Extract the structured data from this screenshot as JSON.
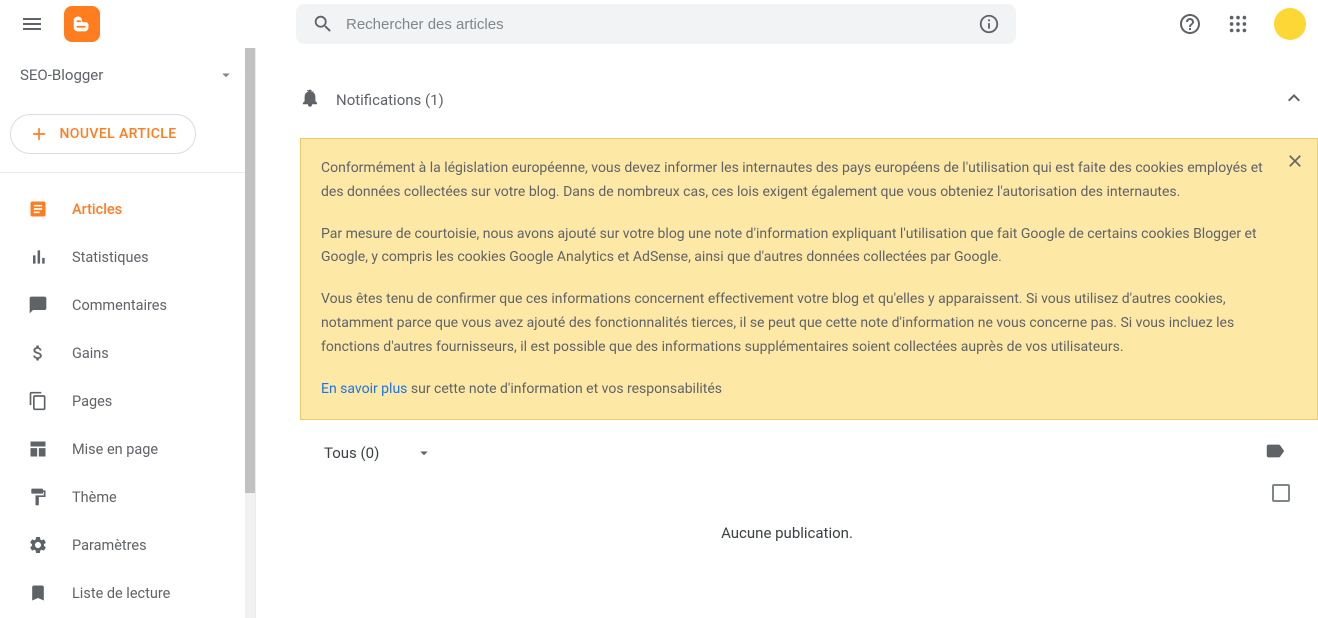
{
  "header": {
    "search_placeholder": "Rechercher des articles"
  },
  "sidebar": {
    "blog_name": "SEO-Blogger",
    "new_post_label": "NOUVEL ARTICLE",
    "nav": [
      {
        "label": "Articles",
        "icon": "doc",
        "active": true
      },
      {
        "label": "Statistiques",
        "icon": "stats",
        "active": false
      },
      {
        "label": "Commentaires",
        "icon": "comment",
        "active": false
      },
      {
        "label": "Gains",
        "icon": "dollar",
        "active": false
      },
      {
        "label": "Pages",
        "icon": "pages",
        "active": false
      },
      {
        "label": "Mise en page",
        "icon": "layout",
        "active": false
      },
      {
        "label": "Thème",
        "icon": "theme",
        "active": false
      },
      {
        "label": "Paramètres",
        "icon": "settings",
        "active": false
      },
      {
        "label": "Liste de lecture",
        "icon": "bookmark",
        "active": false
      }
    ]
  },
  "notifications": {
    "title": "Notifications (1)",
    "p1": "Conformément à la législation européenne, vous devez informer les internautes des pays européens de l'utilisation qui est faite des cookies employés et des données collectées sur votre blog. Dans de nombreux cas, ces lois exigent également que vous obteniez l'autorisation des internautes.",
    "p2": "Par mesure de courtoisie, nous avons ajouté sur votre blog une note d'information expliquant l'utilisation que fait Google de certains cookies Blogger et Google, y compris les cookies Google Analytics et AdSense, ainsi que d'autres données collectées par Google.",
    "p3": "Vous êtes tenu de confirmer que ces informations concernent effectivement votre blog et qu'elles y apparaissent. Si vous utilisez d'autres cookies, notamment parce que vous avez ajouté des fonctionnalités tierces, il se peut que cette note d'information ne vous concerne pas. Si vous incluez les fonctions d'autres fournisseurs, il est possible que des informations supplémentaires soient collectées auprès de vos utilisateurs.",
    "link_text": "En savoir plus",
    "link_suffix": " sur cette note d'information et vos responsabilités"
  },
  "filter": {
    "label": "Tous (0)"
  },
  "empty": {
    "message": "Aucune publication."
  }
}
